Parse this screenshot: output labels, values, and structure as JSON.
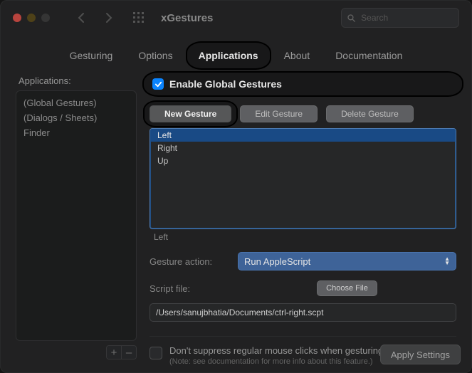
{
  "window": {
    "title": "xGestures"
  },
  "search": {
    "placeholder": "Search"
  },
  "tabs": {
    "items": [
      {
        "label": "Gesturing"
      },
      {
        "label": "Options"
      },
      {
        "label": "Applications"
      },
      {
        "label": "About"
      },
      {
        "label": "Documentation"
      }
    ],
    "active_index": 2
  },
  "sidebar": {
    "heading": "Applications:",
    "items": [
      {
        "label": "(Global Gestures)"
      },
      {
        "label": "(Dialogs / Sheets)"
      },
      {
        "label": "Finder"
      }
    ],
    "add_label": "+",
    "remove_label": "–"
  },
  "main": {
    "enable_global_label": "Enable Global Gestures",
    "enable_global_checked": true,
    "buttons": {
      "new": "New Gesture",
      "edit": "Edit Gesture",
      "delete": "Delete Gesture"
    },
    "gesture_list": {
      "items": [
        {
          "label": "Left",
          "selected": true
        },
        {
          "label": "Right",
          "selected": false
        },
        {
          "label": "Up",
          "selected": false
        }
      ],
      "selected_label": "Left"
    },
    "action": {
      "label": "Gesture action:",
      "value": "Run AppleScript"
    },
    "script": {
      "label": "Script file:",
      "choose_label": "Choose File",
      "path": "/Users/sanujbhatia/Documents/ctrl-right.scpt"
    },
    "suppress": {
      "checked": false,
      "label": "Don't suppress regular mouse clicks when gesturing",
      "note": "(Note: see documentation for more info about this feature.)"
    },
    "apply_label": "Apply Settings"
  }
}
